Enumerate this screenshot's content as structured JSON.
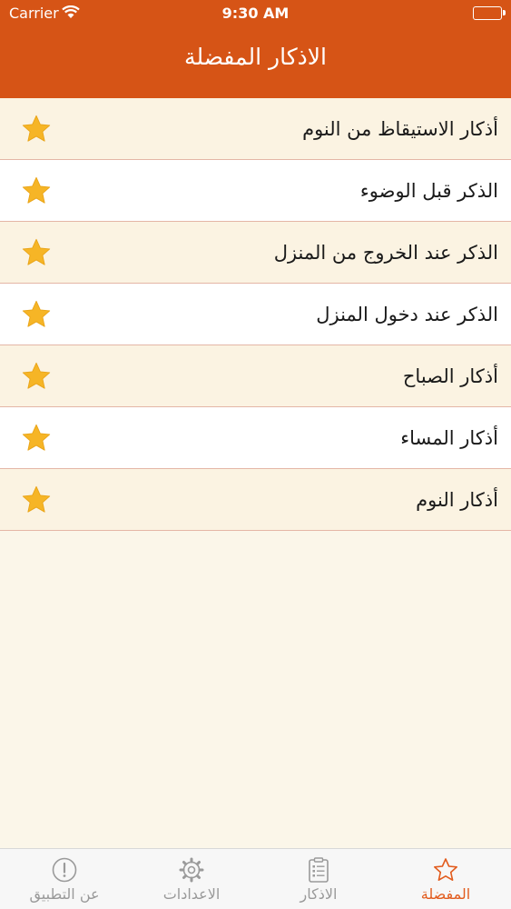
{
  "status_bar": {
    "carrier": "Carrier",
    "time": "9:30 AM"
  },
  "nav": {
    "title": "الاذكار المفضلة"
  },
  "favorites": [
    {
      "label": "أذكار الاستيقاظ من النوم",
      "icon": "star-icon"
    },
    {
      "label": "الذكر قبل الوضوء",
      "icon": "star-icon"
    },
    {
      "label": "الذكر عند الخروج من المنزل",
      "icon": "star-icon"
    },
    {
      "label": "الذكر عند دخول المنزل",
      "icon": "star-icon"
    },
    {
      "label": "أذكار الصباح",
      "icon": "star-icon"
    },
    {
      "label": "أذكار المساء",
      "icon": "star-icon"
    },
    {
      "label": "أذكار النوم",
      "icon": "star-icon"
    }
  ],
  "tabs": [
    {
      "label": "عن التطبيق",
      "icon": "info-circle-icon"
    },
    {
      "label": "الاعدادات",
      "icon": "gear-icon"
    },
    {
      "label": "الاذكار",
      "icon": "clipboard-list-icon"
    },
    {
      "label": "المفضلة",
      "icon": "star-outline-icon",
      "active": true
    }
  ],
  "colors": {
    "header": "#d65416",
    "accent": "#e25c1e",
    "star": "#f6b526",
    "row_alt": "#fbf3e2"
  }
}
